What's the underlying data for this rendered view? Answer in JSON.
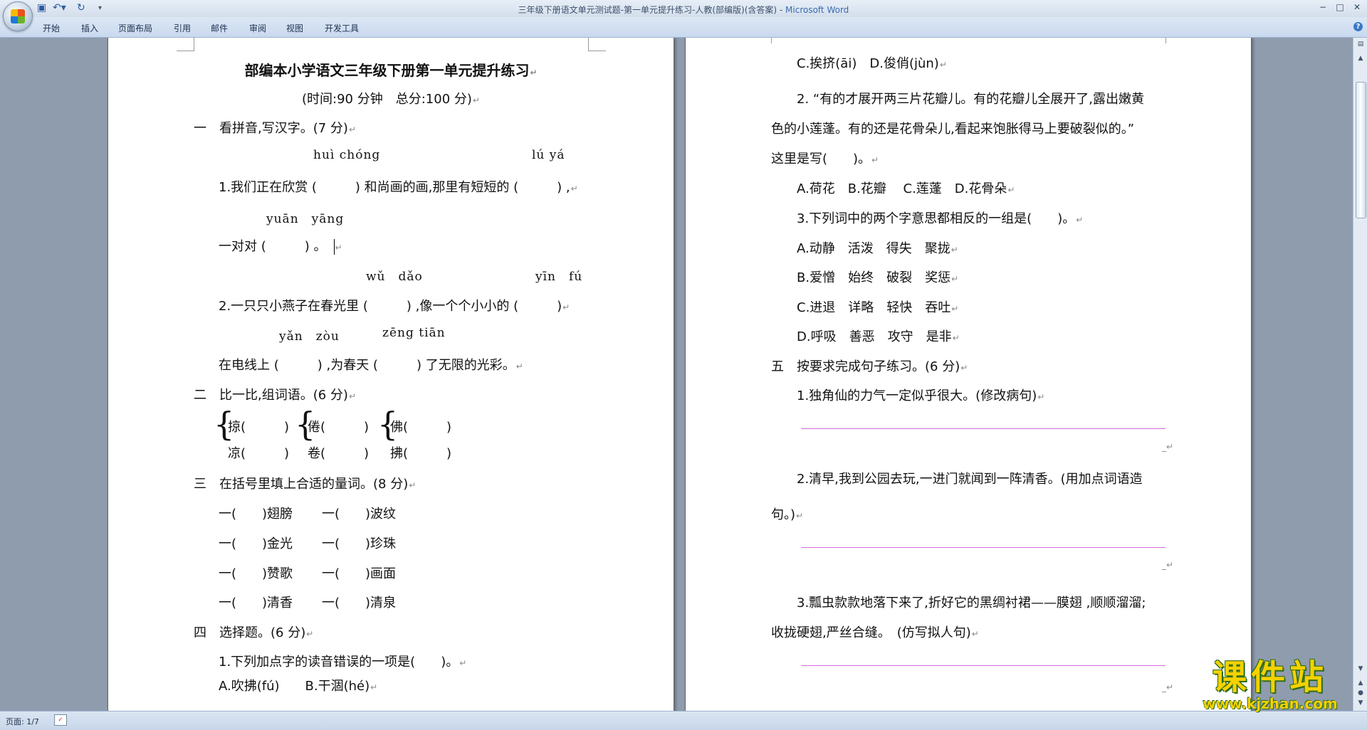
{
  "window": {
    "title_doc": "三年级下册语文单元测试题-第一单元提升练习-人教(部编版)(含答案)",
    "title_sep": " - ",
    "title_app": "Microsoft Word"
  },
  "ribbon": {
    "tabs": [
      "开始",
      "插入",
      "页面布局",
      "引用",
      "邮件",
      "审阅",
      "视图",
      "开发工具"
    ]
  },
  "left_page": {
    "title": "部编本小学语文三年级下册第一单元提升练习",
    "subtitle": "(时间:90 分钟　总分:100 分)",
    "q1": {
      "heading": "一　看拼音,写汉字。(7 分)",
      "pinyin_1a": "huì chóng",
      "pinyin_1b": "lú yá",
      "line_1": "1.我们正在欣赏 (　　　) 和尚画的画,那里有短短的 (　　　) ,",
      "pinyin_1c": "yuān　yāng",
      "line_1c": "一对对 (　　　) 。",
      "pinyin_2a": "wǔ　dǎo",
      "pinyin_2b": "yīn　fú",
      "line_2": "2.一只只小燕子在春光里 (　　　) ,像一个个小小的 (　　　)",
      "pinyin_2c": "yǎn　zòu",
      "pinyin_2d": "zēng tiān",
      "line_2c": "在电线上 (　　　) ,为春天 (　　　) 了无限的光彩。"
    },
    "q2": {
      "heading": "二　比一比,组词语。(6 分)",
      "pairs": [
        {
          "top": "掠(　　　)",
          "bottom": "凉(　　　)"
        },
        {
          "top": "倦(　　　)",
          "bottom": "卷(　　　)"
        },
        {
          "top": "佛(　　　)",
          "bottom": "拂(　　　)"
        }
      ]
    },
    "q3": {
      "heading": "三　在括号里填上合适的量词。(8 分)",
      "rows": [
        [
          "一(　　)翅膀",
          "一(　　)波纹"
        ],
        [
          "一(　　)金光",
          "一(　　)珍珠"
        ],
        [
          "一(　　)赞歌",
          "一(　　)画面"
        ],
        [
          "一(　　)清香",
          "一(　　)清泉"
        ]
      ]
    },
    "q4": {
      "heading": "四　选择题。(6 分)",
      "sub1": "1.下列加点字的读音错误的一项是(　　)。",
      "sub1_ab": "A.吹拂(fú)　　B.干涸(hé)"
    }
  },
  "right_page": {
    "q4_cont": {
      "sub1_cd": "C.挨挤(āi)　D.俊俏(jùn)",
      "sub2_l1": "2. “有的才展开两三片花瓣儿。有的花瓣儿全展开了,露出嫩黄",
      "sub2_l2": "色的小莲蓬。有的还是花骨朵儿,看起来饱胀得马上要破裂似的。”",
      "sub2_l3": "这里是写(　　)。",
      "sub2_opts": "A.荷花　B.花瓣　 C.莲蓬　D.花骨朵",
      "sub3": "3.下列词中的两个字意思都相反的一组是(　　)。",
      "sub3_a": "A.动静　活泼　得失　聚拢",
      "sub3_b": "B.爱憎　始终　破裂　奖惩",
      "sub3_c": "C.进退　详略　轻快　吞吐",
      "sub3_d": "D.呼吸　善恶　攻守　是非"
    },
    "q5": {
      "heading": "五　按要求完成句子练习。(6 分)",
      "s1": "1.独角仙的力气一定似乎很大。(修改病句)",
      "s2_l1": "2.清早,我到公园去玩,一进门就闻到一阵清香。(用加点词语造",
      "s2_l2": "句。)",
      "s3_l1": "3.瓢虫款款地落下来了,折好它的黑绸衬裙——膜翅 ,顺顺溜溜;",
      "s3_l2": "收拢硬翅,严丝合缝。　(仿写拟人句)"
    }
  },
  "status": {
    "page": "页面: 1/7"
  },
  "watermark": {
    "cn": "课件站",
    "url": "www.kjzhan.com"
  },
  "icons": [
    "office-button-icon",
    "save-icon",
    "undo-icon",
    "redo-icon",
    "customize-icon",
    "minimize-icon",
    "maximize-icon",
    "close-icon",
    "help-icon",
    "spell-check-icon",
    "paragraph-mark-icon"
  ]
}
